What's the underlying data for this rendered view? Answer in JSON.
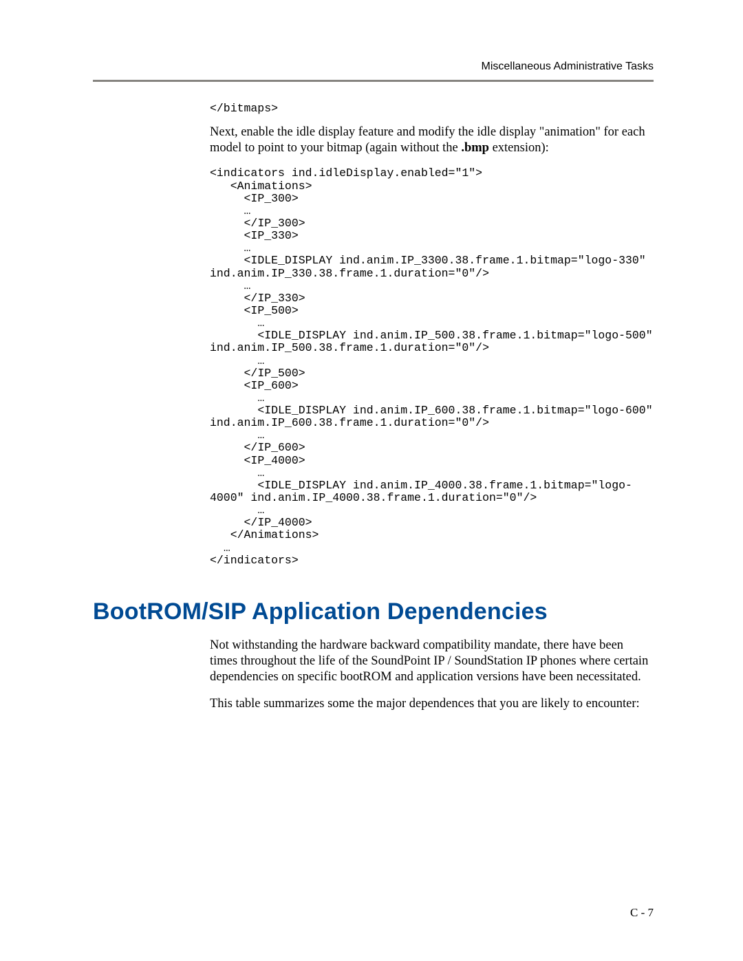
{
  "header": {
    "running_title": "Miscellaneous Administrative Tasks"
  },
  "content": {
    "code_close_bitmaps": "</bitmaps>",
    "para_enable_idle_pre": "Next, enable the idle display feature and modify the idle display \"animation\" for each model to point to your bitmap (again without the ",
    "para_enable_idle_bold": ".bmp",
    "para_enable_idle_post": " extension):",
    "code_indicators": "<indicators ind.idleDisplay.enabled=\"1\">\n   <Animations>\n     <IP_300>\n     …\n     </IP_300>\n     <IP_330>\n     …\n     <IDLE_DISPLAY ind.anim.IP_3300.38.frame.1.bitmap=\"logo-330\" ind.anim.IP_330.38.frame.1.duration=\"0\"/>\n     …\n     </IP_330>\n     <IP_500>\n       …\n       <IDLE_DISPLAY ind.anim.IP_500.38.frame.1.bitmap=\"logo-500\" ind.anim.IP_500.38.frame.1.duration=\"0\"/>\n       …\n     </IP_500>\n     <IP_600>\n       …\n       <IDLE_DISPLAY ind.anim.IP_600.38.frame.1.bitmap=\"logo-600\" ind.anim.IP_600.38.frame.1.duration=\"0\"/>\n       …\n     </IP_600>\n     <IP_4000>\n       …\n       <IDLE_DISPLAY ind.anim.IP_4000.38.frame.1.bitmap=\"logo-4000\" ind.anim.IP_4000.38.frame.1.duration=\"0\"/>\n       …\n     </IP_4000>\n   </Animations>\n  …\n</indicators>",
    "section_heading": "BootROM/SIP Application Dependencies",
    "para_not_withstanding": "Not withstanding the hardware backward compatibility mandate, there have been times throughout the life of the SoundPoint IP / SoundStation IP phones where certain dependencies on specific bootROM and application versions have been necessitated.",
    "para_table_summarizes": "This table summarizes some the major dependences that you are likely to encounter:"
  },
  "footer": {
    "page_number": "C - 7"
  }
}
